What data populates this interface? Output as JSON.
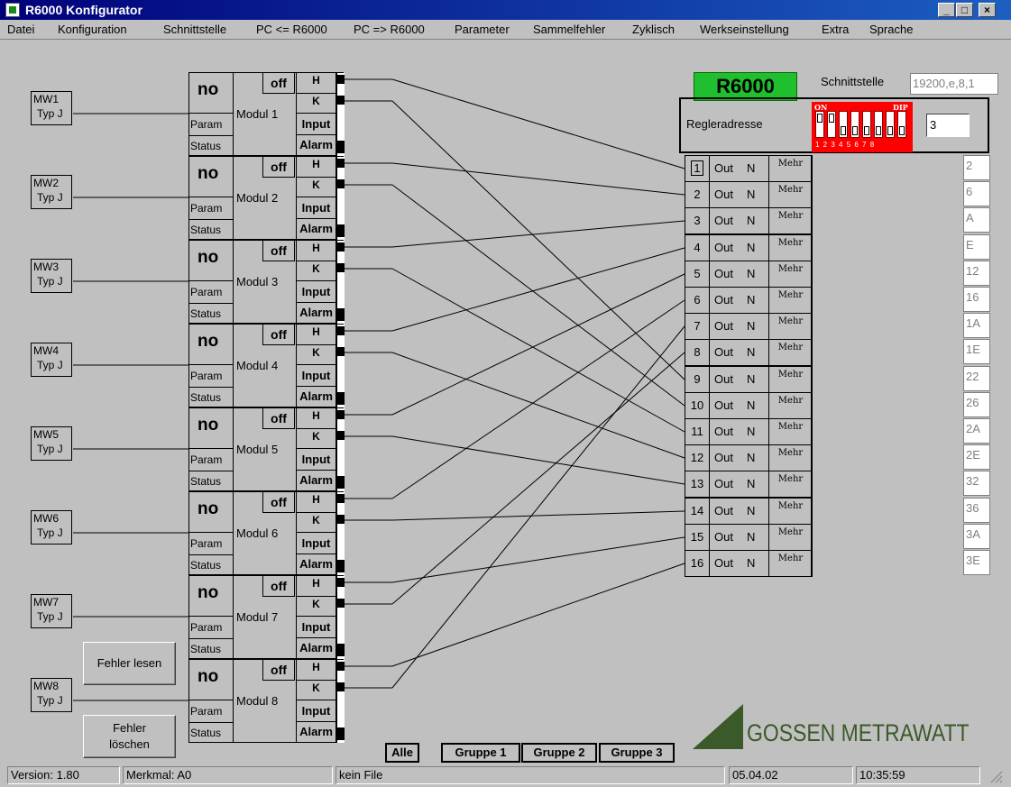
{
  "window": {
    "title": "R6000 Konfigurator",
    "min": "_",
    "max": "□",
    "close": "×"
  },
  "menu": [
    "Datei",
    "Konfiguration",
    "Schnittstelle",
    "PC <= R6000",
    "PC => R6000",
    "Parameter",
    "Sammelfehler",
    "Zyklisch",
    "Werkseinstellung",
    "Extra",
    "Sprache"
  ],
  "mw": [
    {
      "name": "MW1",
      "type": "Typ J"
    },
    {
      "name": "MW2",
      "type": "Typ J"
    },
    {
      "name": "MW3",
      "type": "Typ J"
    },
    {
      "name": "MW4",
      "type": "Typ J"
    },
    {
      "name": "MW5",
      "type": "Typ J"
    },
    {
      "name": "MW6",
      "type": "Typ J"
    },
    {
      "name": "MW7",
      "type": "Typ J"
    },
    {
      "name": "MW8",
      "type": "Typ J"
    }
  ],
  "modules": [
    {
      "no": "no",
      "label": "Modul 1"
    },
    {
      "no": "no",
      "label": "Modul 2"
    },
    {
      "no": "no",
      "label": "Modul 3"
    },
    {
      "no": "no",
      "label": "Modul 4"
    },
    {
      "no": "no",
      "label": "Modul 5"
    },
    {
      "no": "no",
      "label": "Modul 6"
    },
    {
      "no": "no",
      "label": "Modul 7"
    },
    {
      "no": "no",
      "label": "Modul 8"
    }
  ],
  "module_labels": {
    "param": "Param",
    "status": "Status",
    "off": "off",
    "h": "H",
    "k": "K",
    "input": "Input",
    "alarm": "Alarm"
  },
  "r6000": {
    "title": "R6000",
    "accent": "#1fbf2e",
    "schnittstelle_label": "Schnittstelle",
    "schnittstelle_value": "19200,e,8,1",
    "regleradresse_label": "Regleradresse",
    "address": "3",
    "dip_on": "ON",
    "dip_label": "DIP",
    "dip_numbers": "1 2 3 4 5 6 7 8",
    "dip_color": "#ff0000"
  },
  "outputs": {
    "out_label": "Out",
    "n_label": "N",
    "mehr_label": "Mehr",
    "numbers": [
      "1",
      "2",
      "3",
      "4",
      "5",
      "6",
      "7",
      "8",
      "9",
      "10",
      "11",
      "12",
      "13",
      "14",
      "15",
      "16"
    ],
    "hex": [
      "2",
      "6",
      "A",
      "E",
      "12",
      "16",
      "1A",
      "1E",
      "22",
      "26",
      "2A",
      "2E",
      "32",
      "36",
      "3A",
      "3E"
    ]
  },
  "buttons": {
    "fehler_lesen": "Fehler lesen",
    "fehler_loeschen_1": "Fehler",
    "fehler_loeschen_2": "löschen",
    "alle": "Alle",
    "gruppe1": "Gruppe 1",
    "gruppe2": "Gruppe 2",
    "gruppe3": "Gruppe 3"
  },
  "logo": {
    "text": "GOSSEN METRAWATT",
    "color": "#3a5a2a"
  },
  "statusbar": {
    "version": "Version: 1.80",
    "merkmal": "Merkmal:  A0",
    "file": "kein File",
    "date": "05.04.02",
    "time": "10:35:59"
  },
  "connections": [
    [
      1,
      "H",
      1
    ],
    [
      1,
      "K",
      9
    ],
    [
      2,
      "H",
      2
    ],
    [
      2,
      "K",
      10
    ],
    [
      3,
      "H",
      3
    ],
    [
      3,
      "K",
      11
    ],
    [
      4,
      "H",
      4
    ],
    [
      4,
      "K",
      12
    ],
    [
      5,
      "H",
      5
    ],
    [
      5,
      "K",
      13
    ],
    [
      6,
      "H",
      6
    ],
    [
      6,
      "K",
      14
    ],
    [
      7,
      "H",
      15
    ],
    [
      7,
      "K",
      8
    ],
    [
      8,
      "H",
      16
    ],
    [
      8,
      "K",
      7
    ]
  ]
}
